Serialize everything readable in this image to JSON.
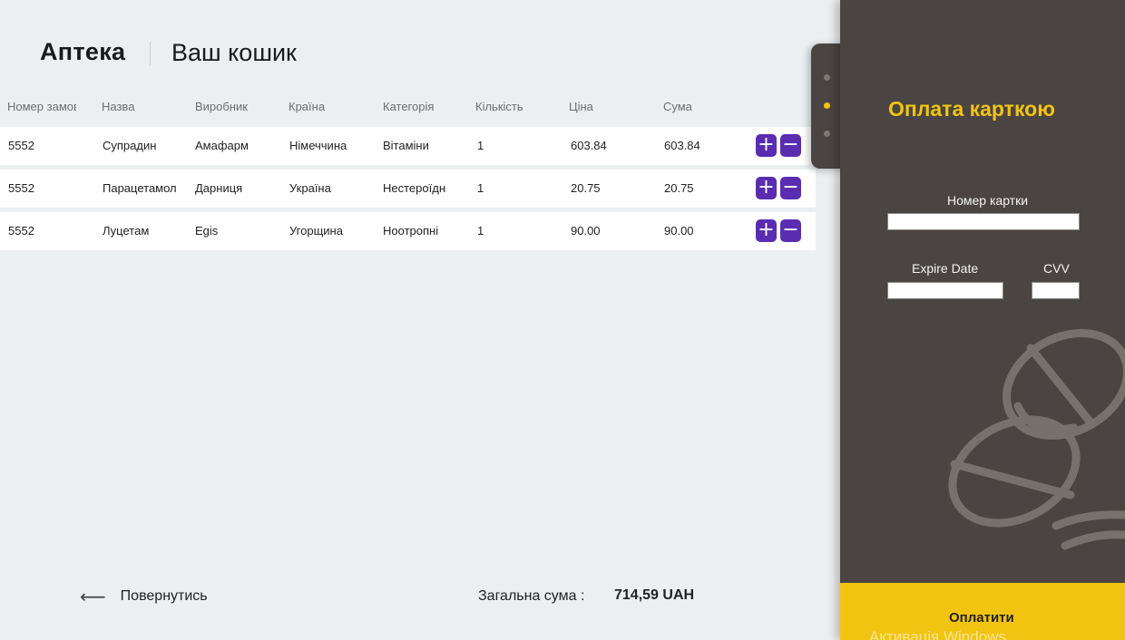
{
  "header": {
    "app_title": "Аптека",
    "page_title": "Ваш кошик"
  },
  "table": {
    "columns": [
      "Номер замовлення",
      "Назва",
      "Виробник",
      "Країна",
      "Категорія",
      "Кількість",
      "Ціна",
      "Сума"
    ],
    "rows": [
      {
        "order": "5552",
        "name": "Супрадин",
        "maker": "Амафарм",
        "country": "Німеччина",
        "category": "Вітаміни",
        "qty": "1",
        "price": "603.84",
        "sum": "603.84"
      },
      {
        "order": "5552",
        "name": "Парацетамол",
        "maker": "Дарниця",
        "country": "Україна",
        "category": "Нестероїдні",
        "qty": "1",
        "price": "20.75",
        "sum": "20.75"
      },
      {
        "order": "5552",
        "name": "Луцетам",
        "maker": "Egis",
        "country": "Угорщина",
        "category": "Ноотропні",
        "qty": "1",
        "price": "90.00",
        "sum": "90.00"
      }
    ],
    "plus_label": "+",
    "minus_label": "−"
  },
  "footer": {
    "back_arrow": "⟵",
    "back_label": "Повернутись",
    "total_label": "Загальна сума :",
    "total_value": "714,59 UAH"
  },
  "payment": {
    "title": "Оплата карткою",
    "card_number_label": "Номер картки",
    "card_number_value": "",
    "expire_label": "Expire Date",
    "expire_value": "",
    "cvv_label": "CVV",
    "cvv_value": "",
    "pay_button_label": "Оплатити",
    "watermark": "Активація Windows",
    "active_step": 2
  },
  "colors": {
    "accent": "#f2c412",
    "panel": "#4a4542",
    "button_purple": "#5a2db0",
    "background": "#ebeff0"
  },
  "icons": {
    "back": "arrow-left-icon",
    "plus": "plus-icon",
    "minus": "minus-icon",
    "decor": "pill-icon"
  }
}
